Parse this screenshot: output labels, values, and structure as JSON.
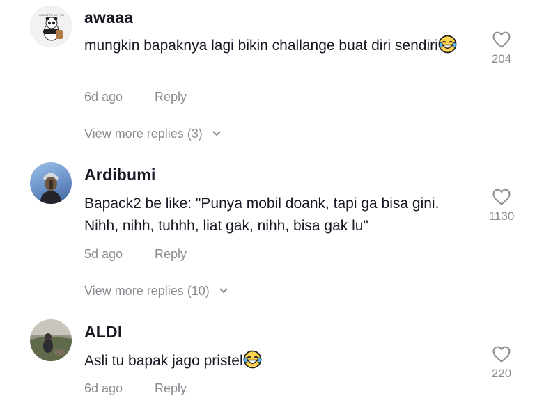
{
  "comments": [
    {
      "username": "awaaa",
      "text": "mungkin bapaknya lagi bikin challange buat diri sendiri",
      "time": "6d ago",
      "reply_label": "Reply",
      "likes": "204",
      "more_replies": "View more replies (3)",
      "avatar_caption": "I WANT TO BE YOU"
    },
    {
      "username": "Ardibumi",
      "text": "Bapack2 be like: \"Punya mobil doank, tapi ga bisa gini. Nihh, nihh, tuhhh, liat gak, nihh, bisa gak lu\"",
      "time": "5d ago",
      "reply_label": "Reply",
      "likes": "1130",
      "more_replies": "View more replies (10)"
    },
    {
      "username": "ALDI",
      "text": "Asli tu bapak jago pristel",
      "time": "6d ago",
      "reply_label": "Reply",
      "likes": "220"
    }
  ],
  "icons": {
    "like": "heart-outline-icon",
    "expand": "chevron-down-icon",
    "emoji": "tears-of-joy-emoji-icon"
  },
  "colors": {
    "text": "#161823",
    "muted": "#8a8b91"
  }
}
